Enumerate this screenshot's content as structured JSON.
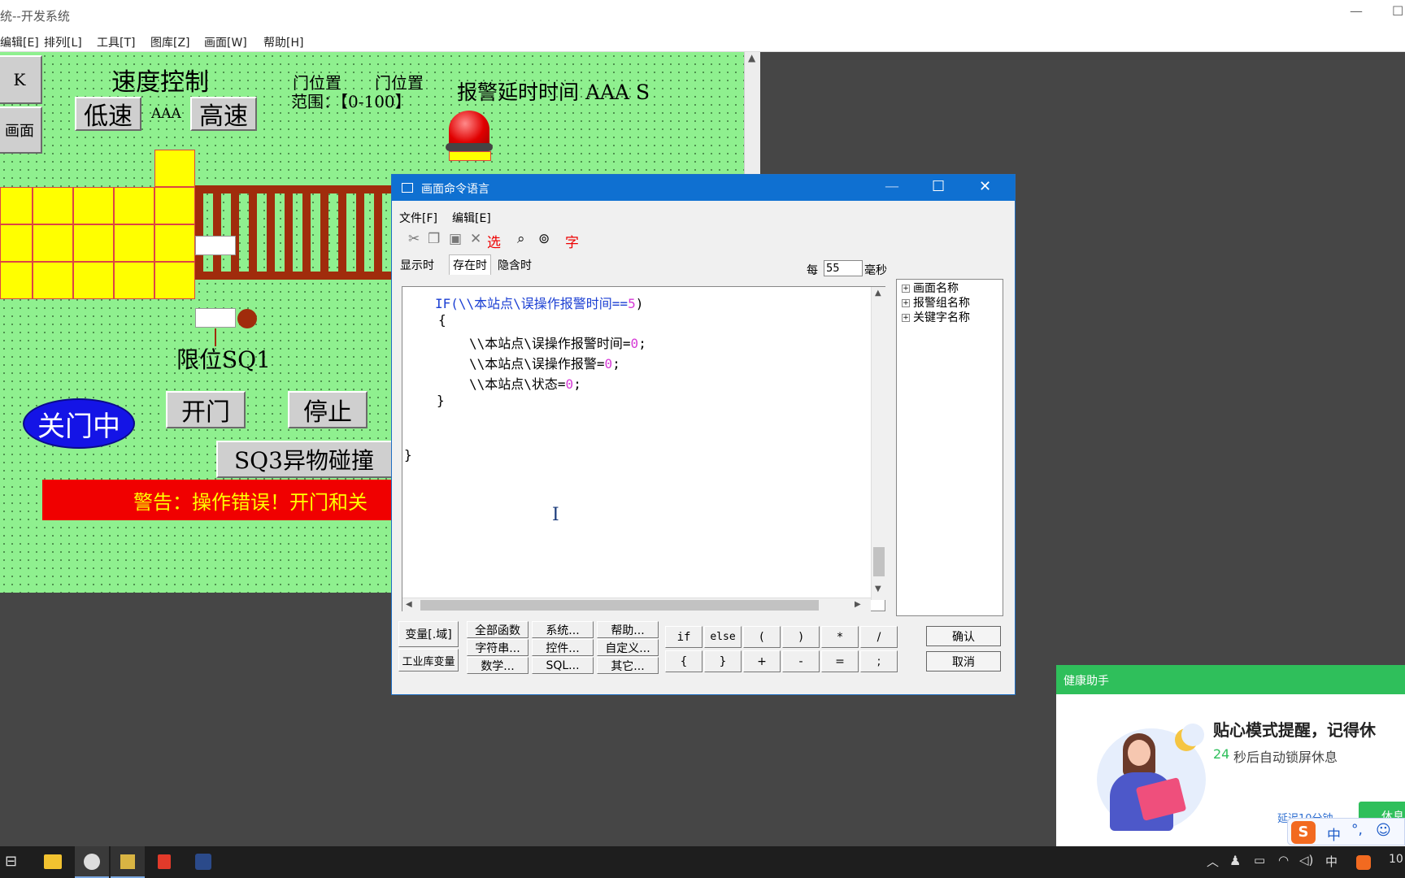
{
  "window": {
    "title": "统--开发系统",
    "minimize": "—",
    "maximize": "☐"
  },
  "menubar": [
    "编辑[E]",
    "排列[L]",
    "工具[T]",
    "图库[Z]",
    "画面[W]",
    "帮助[H]"
  ],
  "canvas": {
    "left_buttons": [
      "K",
      "画面"
    ],
    "speed_title": "速度控制",
    "low_speed": "低速",
    "speed_value": "AAA",
    "high_speed": "高速",
    "door_pos_label1": "门位置",
    "door_pos_label2": "门位置",
    "door_range": "范围：【0-100】",
    "alarm_delay": "报警延时时间 AAA S",
    "limit_label": "限位SQ1",
    "closing_status": "关门中",
    "open_button": "开门",
    "stop_button": "停止",
    "sq3_button": "SQ3异物碰撞",
    "warning_text": "警告：操作错误！开门和关"
  },
  "dialog": {
    "title": "画面命令语言",
    "menu": [
      "文件[F]",
      "编辑[E]"
    ],
    "toolbar": {
      "select": "选",
      "font": "字"
    },
    "tabs": [
      "显示时",
      "存在时",
      "隐含时"
    ],
    "interval_label_before": "每",
    "interval_value": "55",
    "interval_label_after": "毫秒",
    "code_lines": {
      "l1a": "IF(\\\\本站点\\误操作报警时间==",
      "l1n": "5",
      "l1b": ")",
      "l2": "{",
      "l3a": "\\\\本站点\\误操作报警时间=",
      "l3n": "0",
      "l3b": ";",
      "l4a": "\\\\本站点\\误操作报警=",
      "l4n": "0",
      "l4b": ";",
      "l5a": "\\\\本站点\\状态=",
      "l5n": "0",
      "l5b": ";",
      "l6": "}",
      "l7": "}"
    },
    "tree": [
      "画面名称",
      "报警组名称",
      "关键字名称"
    ],
    "left_btns": [
      "变量[.域]",
      "工业库变量"
    ],
    "func_btns": [
      "全部函数",
      "系统...",
      "帮助...",
      "字符串...",
      "控件...",
      "自定义...",
      "数学...",
      "SQL...",
      "其它..."
    ],
    "op_btns": [
      "if",
      "else",
      "(",
      ")",
      "*",
      "/",
      "{",
      "}",
      "+",
      "-",
      "=",
      ";"
    ],
    "ok": "确认",
    "cancel": "取消"
  },
  "health": {
    "title": "健康助手",
    "headline": "贴心模式提醒，记得休",
    "countdown_num": "24",
    "countdown_text": "秒后自动锁屏休息",
    "delay_link": "延迟10分钟",
    "rest_button": "休息"
  },
  "taskbar": {
    "ime": "中",
    "clock": "10"
  }
}
